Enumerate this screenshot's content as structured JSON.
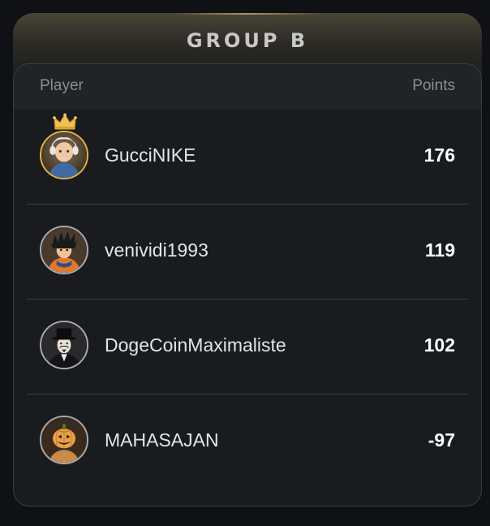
{
  "group": {
    "title": "GROUP B"
  },
  "table": {
    "col_player": "Player",
    "col_points": "Points"
  },
  "players": [
    {
      "name": "GucciNIKE",
      "points": "176",
      "avatar_icon": "old-man-avatar",
      "crown_icon": "gold-crown",
      "leader": true
    },
    {
      "name": "venividi1993",
      "points": "119",
      "avatar_icon": "spiky-hair-fighter-avatar",
      "leader": false
    },
    {
      "name": "DogeCoinMaximaliste",
      "points": "102",
      "avatar_icon": "masked-top-hat-avatar",
      "leader": false
    },
    {
      "name": "MAHASAJAN",
      "points": "-97",
      "avatar_icon": "pumpkin-head-avatar",
      "leader": false
    }
  ],
  "colors": {
    "background": "#101114",
    "panel": "#1a1b1e",
    "header_row": "#222327",
    "gold_accent": "#e0b24a",
    "text_primary": "#ffffff",
    "text_muted": "#8b8d92"
  }
}
